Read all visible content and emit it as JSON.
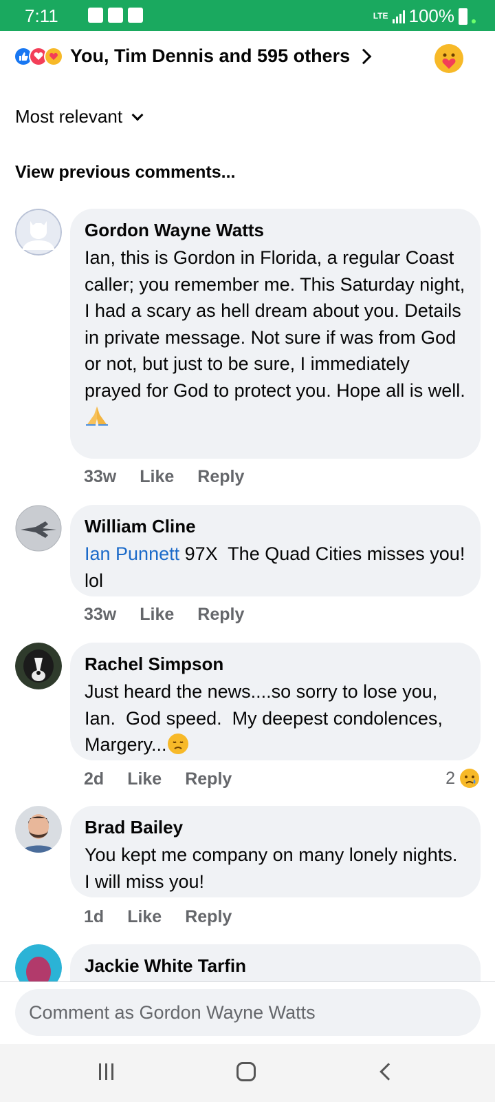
{
  "status_bar": {
    "time": "7:11",
    "network": "LTE",
    "battery": "100%",
    "notification_icons": [
      "facebook-icon",
      "app-icon",
      "gallery-icon"
    ]
  },
  "reactions_header": {
    "icons": [
      "like-reaction-icon",
      "love-reaction-icon",
      "care-reaction-icon"
    ],
    "text": "You, Tim Dennis and 595 others",
    "user_reaction": "care-reaction-icon"
  },
  "sort": {
    "label": "Most relevant"
  },
  "view_previous": "View previous comments...",
  "comments": [
    {
      "name": "Gordon Wayne Watts",
      "text": "Ian, this is Gordon in Florida, a regular Coast caller; you remember me. This Saturday night, I had a scary as hell dream about you. Details in private message. Not sure if was from God or not, but just to be sure, I immediately prayed for God to protect you. Hope all is well.",
      "emoji": "pray-emoji",
      "time": "33w",
      "like": "Like",
      "reply": "Reply"
    },
    {
      "name": "William Cline",
      "mention": "Ian Punnett",
      "text": " 97X  The Quad Cities misses you!  lol",
      "time": "33w",
      "like": "Like",
      "reply": "Reply"
    },
    {
      "name": "Rachel Simpson",
      "text": "Just heard the news....so sorry to lose you, Ian.  God speed.  My deepest condolences, Margery...",
      "emoji": "disappointed-emoji",
      "time": "2d",
      "like": "Like",
      "reply": "Reply",
      "reaction_count": "2",
      "reaction_icon": "sad-reaction-icon"
    },
    {
      "name": "Brad Bailey",
      "text": "You kept me company on many lonely nights.  I will miss you!",
      "time": "1d",
      "like": "Like",
      "reply": "Reply"
    },
    {
      "name": "Jackie White Tarfin"
    }
  ],
  "comment_input": {
    "placeholder": "Comment as Gordon Wayne Watts"
  },
  "nav_bar": [
    "recents-icon",
    "home-icon",
    "back-icon"
  ]
}
